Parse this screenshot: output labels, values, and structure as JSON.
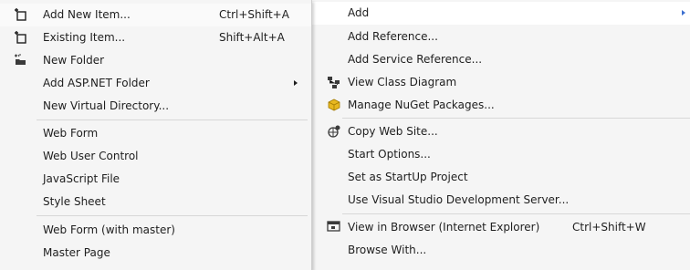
{
  "left_menu": {
    "items": [
      {
        "label": "Add New Item...",
        "shortcut": "Ctrl+Shift+A",
        "icon": "add-new-item-icon"
      },
      {
        "label": "Existing Item...",
        "shortcut": "Shift+Alt+A",
        "icon": "existing-item-icon"
      },
      {
        "label": "New Folder",
        "shortcut": "",
        "icon": "new-folder-icon"
      },
      {
        "label": "Add ASP.NET Folder",
        "shortcut": "",
        "icon": ""
      },
      {
        "label": "New Virtual Directory...",
        "shortcut": "",
        "icon": ""
      },
      {
        "label": "Web Form",
        "shortcut": "",
        "icon": ""
      },
      {
        "label": "Web User Control",
        "shortcut": "",
        "icon": ""
      },
      {
        "label": "JavaScript File",
        "shortcut": "",
        "icon": ""
      },
      {
        "label": "Style Sheet",
        "shortcut": "",
        "icon": ""
      },
      {
        "label": "Web Form (with master)",
        "shortcut": "",
        "icon": ""
      },
      {
        "label": "Master Page",
        "shortcut": "",
        "icon": ""
      }
    ]
  },
  "right_menu": {
    "items": [
      {
        "label": "Add",
        "shortcut": "",
        "icon": ""
      },
      {
        "label": "Add Reference...",
        "shortcut": "",
        "icon": ""
      },
      {
        "label": "Add Service Reference...",
        "shortcut": "",
        "icon": ""
      },
      {
        "label": "View Class Diagram",
        "shortcut": "",
        "icon": "class-diagram-icon"
      },
      {
        "label": "Manage NuGet Packages...",
        "shortcut": "",
        "icon": "nuget-icon"
      },
      {
        "label": "Copy Web Site...",
        "shortcut": "",
        "icon": "copy-web-site-icon"
      },
      {
        "label": "Start Options...",
        "shortcut": "",
        "icon": ""
      },
      {
        "label": "Set as StartUp Project",
        "shortcut": "",
        "icon": ""
      },
      {
        "label": "Use Visual Studio Development Server...",
        "shortcut": "",
        "icon": ""
      },
      {
        "label": "View in Browser (Internet Explorer)",
        "shortcut": "Ctrl+Shift+W",
        "icon": "browser-icon"
      },
      {
        "label": "Browse With...",
        "shortcut": "",
        "icon": ""
      }
    ]
  },
  "colors": {
    "menu_background": "#f5f5f5",
    "separator": "#d7d7d7",
    "submenu_arrow_active": "#3c6fd0"
  }
}
